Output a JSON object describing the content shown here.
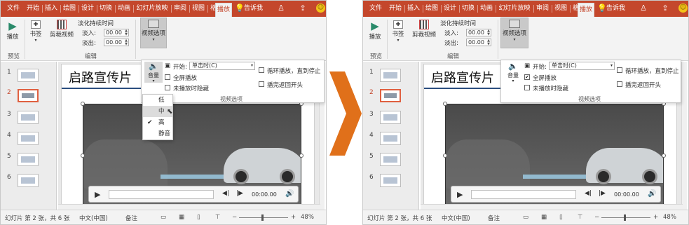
{
  "ribbon_tabs": [
    "文件",
    "开始",
    "插入",
    "绘图",
    "设计",
    "切换",
    "动画",
    "幻灯片放映",
    "审阅",
    "视图",
    "格式",
    "播放"
  ],
  "tell_me": "告诉我",
  "ribbon": {
    "play_label": "播放",
    "preview_group": "预览",
    "bookmark_label": "书签",
    "trim_label": "剪裁视频",
    "fade_title": "淡化持续时间",
    "fade_in_label": "淡入:",
    "fade_out_label": "淡出:",
    "fade_in_value": "00.00",
    "fade_out_value": "00.00",
    "edit_group": "编辑",
    "video_options_label": "视频选项"
  },
  "slide_title": "启路宣传片",
  "thumbs": [
    "1",
    "2",
    "3",
    "4",
    "5",
    "6"
  ],
  "player_time": "00:00.00",
  "flyout": {
    "volume_label": "音量",
    "start_label": "开始:",
    "start_value": "单击时(C)",
    "fullscreen": "全屏播放",
    "hide_not_playing": "未播放时隐藏",
    "loop": "循环播放，直到停止",
    "rewind": "播完返回开头",
    "caption": "视频选项"
  },
  "volume_menu": [
    "低",
    "中",
    "高",
    "静音"
  ],
  "status": {
    "slide_info": "幻灯片 第 2 张，共 6 张",
    "language": "中文(中国)",
    "notes": "备注",
    "zoom": "48%"
  },
  "colors": {
    "accent": "#c4472c",
    "arrow": "#e0701a"
  }
}
